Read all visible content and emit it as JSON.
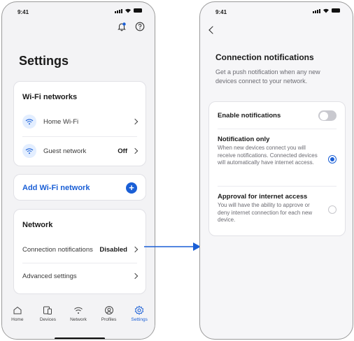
{
  "status_bar": {
    "time": "9:41"
  },
  "settings_screen": {
    "title": "Settings",
    "wifi_section": {
      "title": "Wi-Fi networks",
      "items": [
        {
          "label": "Home Wi-Fi",
          "value": ""
        },
        {
          "label": "Guest network",
          "value": "Off"
        }
      ]
    },
    "add_network_label": "Add Wi-Fi network",
    "network_section": {
      "title": "Network",
      "items": [
        {
          "label": "Connection notifications",
          "value": "Disabled"
        },
        {
          "label": "Advanced settings",
          "value": ""
        }
      ]
    },
    "tabs": [
      {
        "label": "Home",
        "icon": "home-icon",
        "active": false
      },
      {
        "label": "Devices",
        "icon": "devices-icon",
        "active": false
      },
      {
        "label": "Network",
        "icon": "wifi-icon",
        "active": false
      },
      {
        "label": "Profiles",
        "icon": "profile-icon",
        "active": false
      },
      {
        "label": "Settings",
        "icon": "gear-icon",
        "active": true
      }
    ]
  },
  "notifications_screen": {
    "title": "Connection notifications",
    "description": "Get a push notification when any new devices connect to your network.",
    "enable_label": "Enable notifications",
    "enable_on": false,
    "options": [
      {
        "title": "Notification only",
        "description": "When new devices connect you will receive notifications. Connected devices will automatically have internet access.",
        "selected": true
      },
      {
        "title": "Approval for internet access",
        "description": "You will have the ability to approve or deny internet connection for each new device.",
        "selected": false
      }
    ]
  },
  "colors": {
    "accent": "#1a5fd6",
    "background": "#f3f3f5",
    "card": "#ffffff",
    "toggle_off": "#c9c9cf"
  }
}
